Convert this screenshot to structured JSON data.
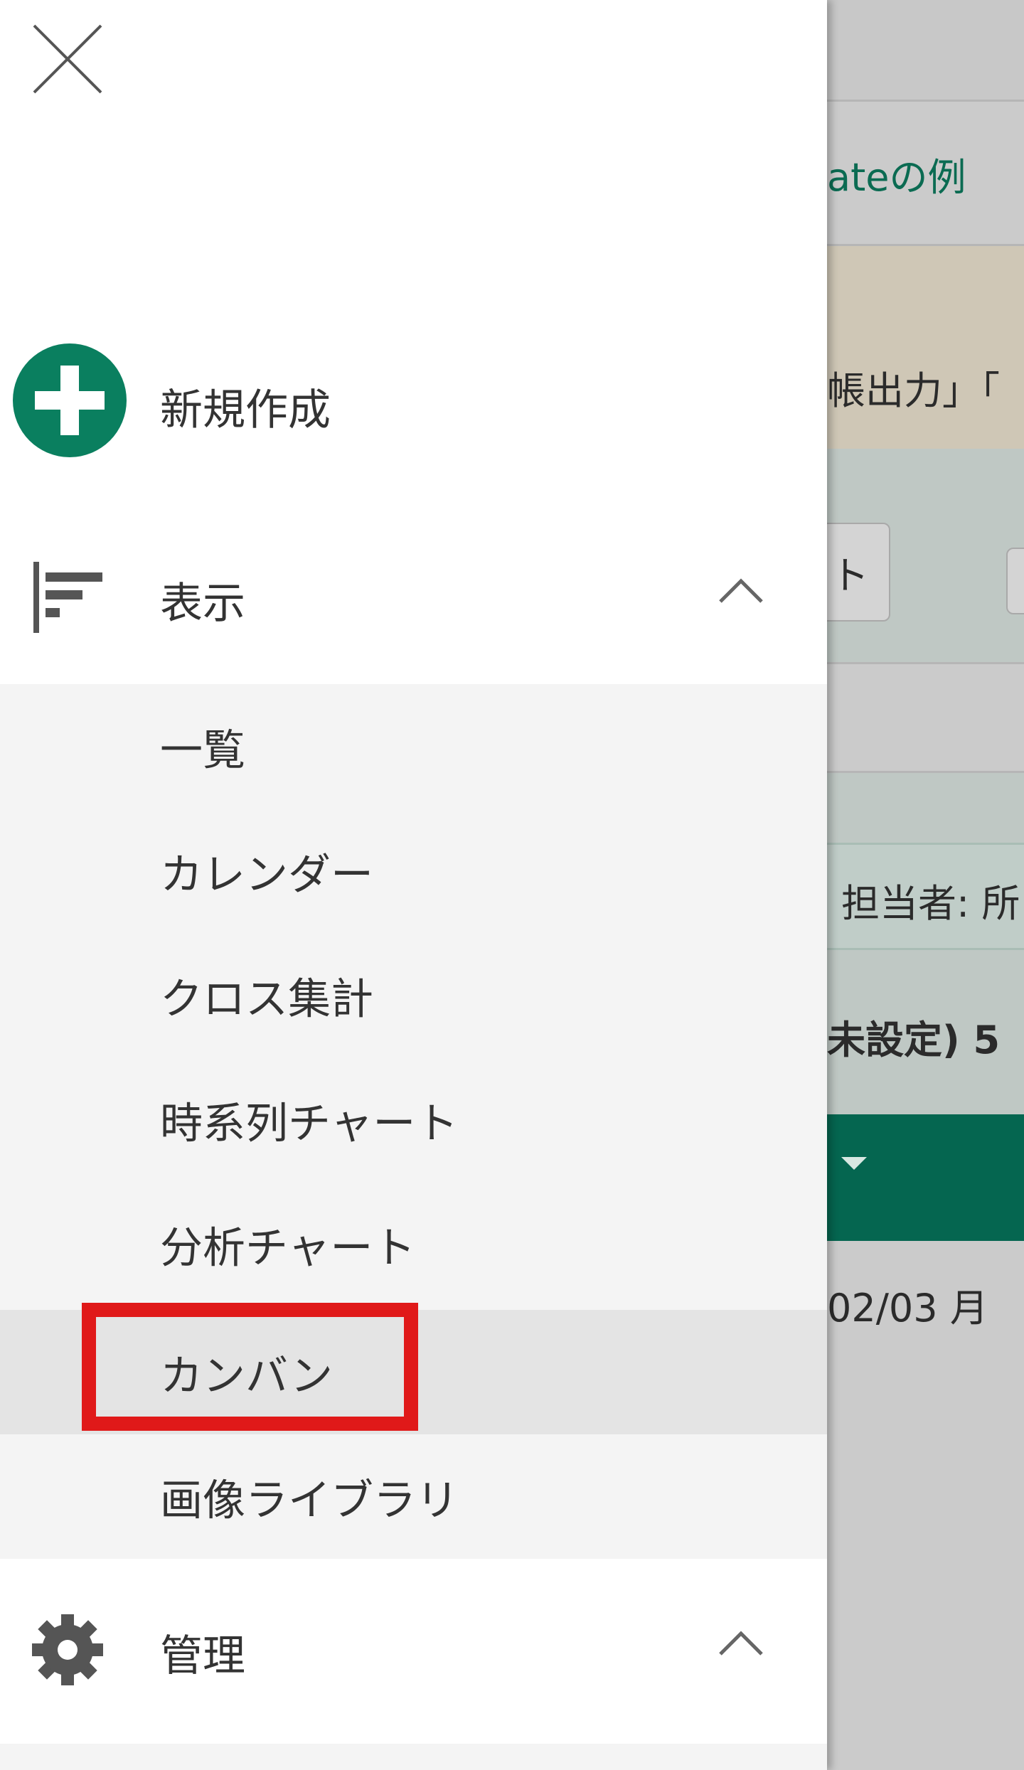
{
  "background": {
    "title_fragment": "ateの例",
    "notice_fragment": "帳出力」「",
    "button_fragment": "ト",
    "filter_fragment": "担当者: 所",
    "group_fragment": "未設定) 5",
    "date_fragment": "02/03 月"
  },
  "drawer": {
    "new_label": "新規作成",
    "view_section_label": "表示",
    "view_items": [
      {
        "label": "一覧"
      },
      {
        "label": "カレンダー"
      },
      {
        "label": "クロス集計"
      },
      {
        "label": "時系列チャート"
      },
      {
        "label": "分析チャート"
      },
      {
        "label": "カンバン",
        "active": true
      },
      {
        "label": "画像ライブラリ"
      }
    ],
    "admin_section_label": "管理"
  },
  "colors": {
    "accent": "#0a7f5f",
    "header_dark": "#056650",
    "highlight": "#e01919"
  }
}
